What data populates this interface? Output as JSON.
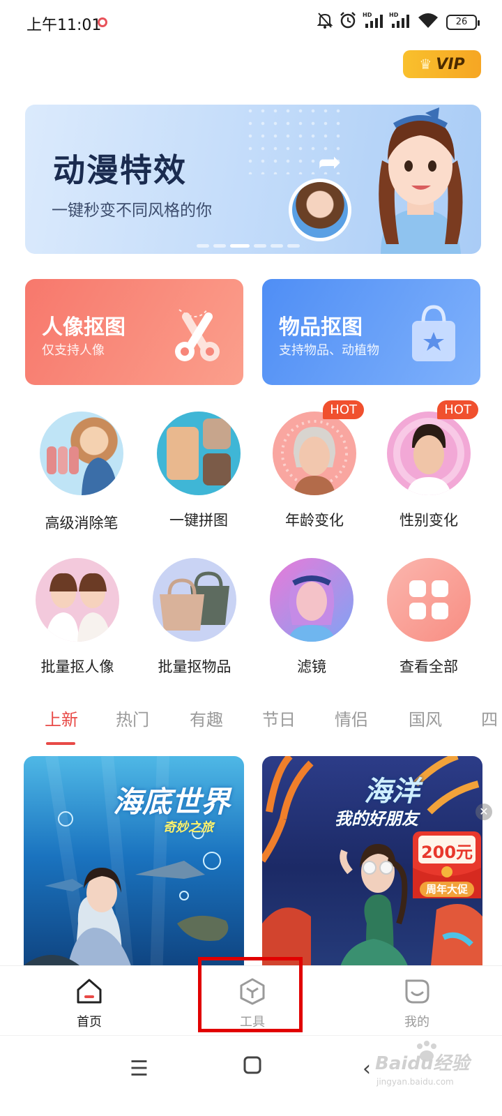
{
  "status_bar": {
    "time": "上午11:01",
    "battery": "26",
    "icons": [
      "mute-icon",
      "alarm-icon",
      "signal-icon",
      "signal-icon",
      "wifi-icon",
      "battery-icon"
    ]
  },
  "vip": {
    "label": "VIP"
  },
  "banner": {
    "title": "动漫特效",
    "subtitle": "一键秒变不同风格的你",
    "page_count": 6,
    "active_page": 3
  },
  "cutout_cards": [
    {
      "title": "人像抠图",
      "subtitle": "仅支持人像"
    },
    {
      "title": "物品抠图",
      "subtitle": "支持物品、动植物"
    }
  ],
  "tools": [
    {
      "label": "高级消除笔",
      "hot": ""
    },
    {
      "label": "一键拼图",
      "hot": ""
    },
    {
      "label": "年龄变化",
      "hot": "HOT"
    },
    {
      "label": "性别变化",
      "hot": "HOT"
    },
    {
      "label": "批量抠人像",
      "hot": ""
    },
    {
      "label": "批量抠物品",
      "hot": ""
    },
    {
      "label": "滤镜",
      "hot": ""
    },
    {
      "label": "查看全部",
      "hot": ""
    }
  ],
  "categories": {
    "tabs": [
      "上新",
      "热门",
      "有趣",
      "节日",
      "情侣",
      "国风",
      "四"
    ],
    "active": "上新"
  },
  "feed": [
    {
      "title": "海底世界",
      "subtitle": "奇妙之旅"
    },
    {
      "title": "海洋",
      "subtitle": "我的好朋友"
    }
  ],
  "promo": {
    "amount": "200元",
    "label": "周年大促"
  },
  "bottom_nav": [
    {
      "label": "首页",
      "active": true
    },
    {
      "label": "工具",
      "active": false
    },
    {
      "label": "我的",
      "active": false
    }
  ],
  "watermark": {
    "text": "Baidu经验",
    "url": "jingyan.baidu.com"
  },
  "colors": {
    "accent": "#e84a47",
    "portrait_card": "#f7786c",
    "object_card": "#4f8ef5",
    "highlight_box": "#e10000",
    "vip": "#f6a623"
  }
}
